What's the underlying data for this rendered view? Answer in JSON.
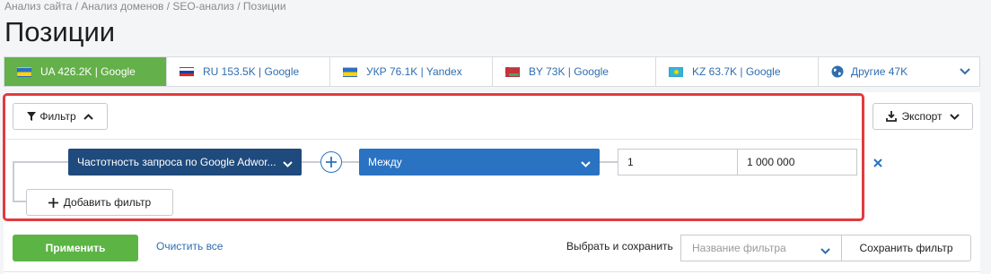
{
  "breadcrumb": "Анализ сайта / Анализ доменов / SEO-анализ / Позиции",
  "page_title": "Позиции",
  "tabs": [
    {
      "label": "UA 426.2K | Google",
      "flag": "ua",
      "active": true
    },
    {
      "label": "RU 153.5K | Google",
      "flag": "ru",
      "active": false
    },
    {
      "label": "УКР 76.1K | Yandex",
      "flag": "ua",
      "active": false
    },
    {
      "label": "BY 73K | Google",
      "flag": "by",
      "active": false
    },
    {
      "label": "KZ 63.7K | Google",
      "flag": "kz",
      "active": false
    },
    {
      "label": "Другие 47K",
      "flag": "globe",
      "active": false
    }
  ],
  "toolbar": {
    "filter_label": "Фильтр",
    "export_label": "Экспорт"
  },
  "filter_row": {
    "field": "Частотность запроса по Google Adwor...",
    "operator": "Между",
    "from_value": "1",
    "to_value": "1 000 000"
  },
  "add_filter_label": "Добавить фильтр",
  "footer": {
    "apply_label": "Применить",
    "clear_label": "Очистить все",
    "save_choose_label": "Выбрать и сохранить",
    "filter_name_placeholder": "Название фильтра",
    "save_filter_label": "Сохранить фильтр"
  },
  "colors": {
    "active_tab": "#64b04a",
    "link": "#2f6db0",
    "field_select": "#1f4a7d",
    "operator_select": "#2a72c2",
    "highlight_frame": "#e23b3f",
    "apply": "#5cb445"
  }
}
